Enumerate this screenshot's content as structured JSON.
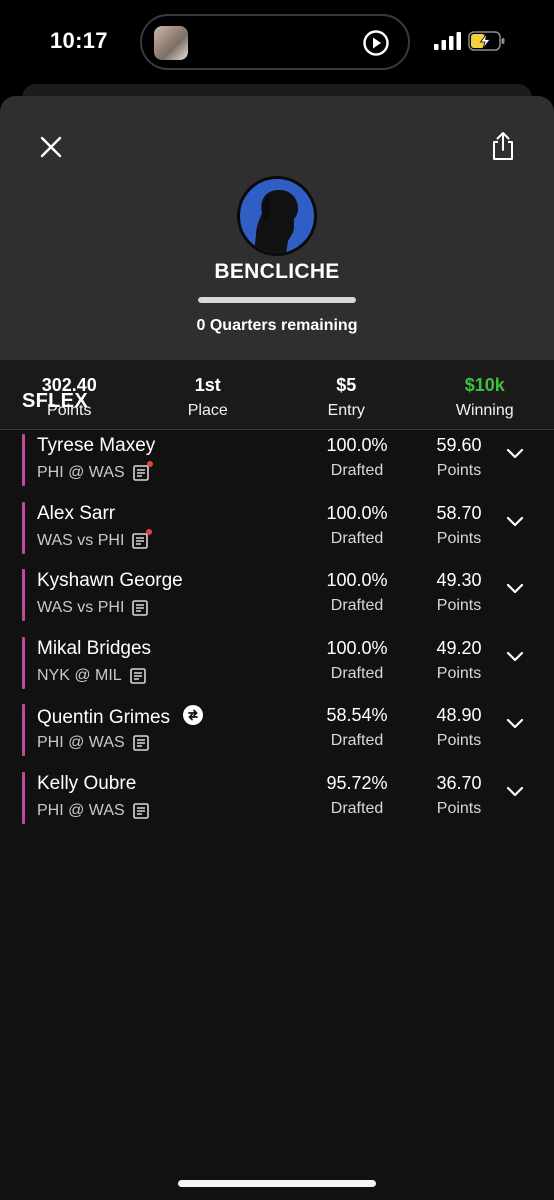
{
  "status_bar": {
    "time": "10:17"
  },
  "header": {
    "username": "BENCLICHE",
    "remaining_text": "0 Quarters remaining",
    "progress_fraction": 1.0
  },
  "stats": [
    {
      "value": "302.40",
      "label": "Points"
    },
    {
      "value": "1st",
      "label": "Place"
    },
    {
      "value": "$5",
      "label": "Entry"
    },
    {
      "value": "$10k",
      "label": "Winning"
    }
  ],
  "colors": {
    "accent_green": "#3fbf3f",
    "player_bar": "#c3489b",
    "avatar_bg": "#2f5fc4"
  },
  "section": {
    "title": "SFLEX"
  },
  "players": [
    {
      "name": "Tyrese Maxey",
      "game": "PHI @ WAS",
      "drafted": "100.0%",
      "drafted_label": "Drafted",
      "points": "59.60",
      "points_label": "Points"
    },
    {
      "name": "Alex Sarr",
      "game": "WAS vs PHI",
      "drafted": "100.0%",
      "drafted_label": "Drafted",
      "points": "58.70",
      "points_label": "Points"
    },
    {
      "name": "Kyshawn George",
      "game": "WAS vs PHI",
      "drafted": "100.0%",
      "drafted_label": "Drafted",
      "points": "49.30",
      "points_label": "Points"
    },
    {
      "name": "Mikal Bridges",
      "game": "NYK @ MIL",
      "drafted": "100.0%",
      "drafted_label": "Drafted",
      "points": "49.20",
      "points_label": "Points"
    },
    {
      "name": "Quentin Grimes",
      "game": "PHI @ WAS",
      "drafted": "58.54%",
      "drafted_label": "Drafted",
      "points": "48.90",
      "points_label": "Points"
    },
    {
      "name": "Kelly Oubre",
      "game": "PHI @ WAS",
      "drafted": "95.72%",
      "drafted_label": "Drafted",
      "points": "36.70",
      "points_label": "Points"
    }
  ],
  "icons": {
    "close": "close-icon",
    "share": "share-icon",
    "expand": "chevron-down-icon",
    "news": "news-icon",
    "swap": "swap-icon",
    "play": "play-icon"
  }
}
